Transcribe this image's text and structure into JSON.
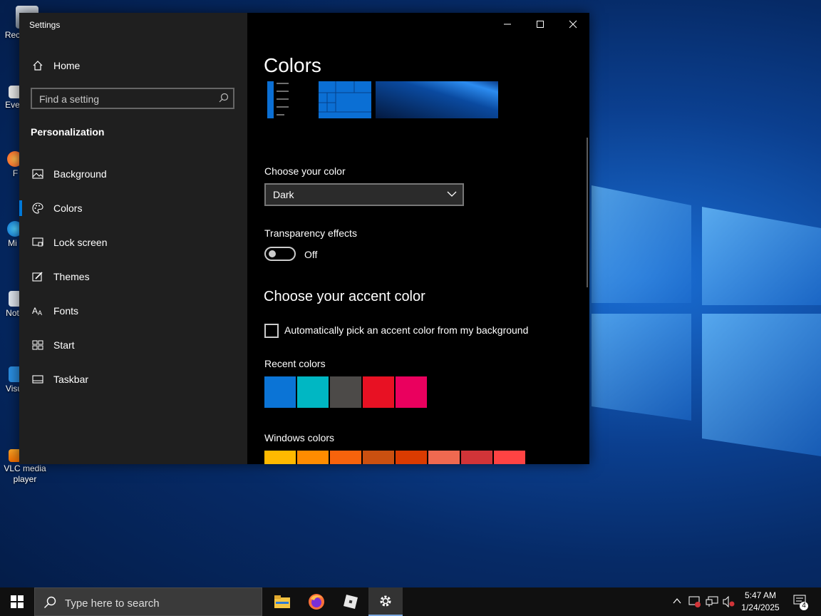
{
  "desktop": {
    "icons": [
      {
        "label": "Rec"
      },
      {
        "label": "Eve"
      },
      {
        "label": "F"
      },
      {
        "label": "Mi"
      },
      {
        "label": "Not"
      },
      {
        "label": "Visu"
      },
      {
        "label": "VLC media player"
      }
    ]
  },
  "window": {
    "title": "Settings",
    "sidebar": {
      "home_label": "Home",
      "search_placeholder": "Find a setting",
      "section_title": "Personalization",
      "items": [
        {
          "label": "Background",
          "icon": "picture-icon"
        },
        {
          "label": "Colors",
          "icon": "palette-icon",
          "selected": true
        },
        {
          "label": "Lock screen",
          "icon": "lock-screen-icon"
        },
        {
          "label": "Themes",
          "icon": "brush-icon"
        },
        {
          "label": "Fonts",
          "icon": "font-icon"
        },
        {
          "label": "Start",
          "icon": "start-grid-icon"
        },
        {
          "label": "Taskbar",
          "icon": "taskbar-icon"
        }
      ]
    },
    "content": {
      "page_title": "Colors",
      "choose_color_label": "Choose your color",
      "choose_color_value": "Dark",
      "transparency_label": "Transparency effects",
      "transparency_state": "Off",
      "accent_heading": "Choose your accent color",
      "auto_accent_label": "Automatically pick an accent color from my background",
      "auto_accent_checked": false,
      "recent_colors_label": "Recent colors",
      "recent_colors": [
        "#0b74d6",
        "#00b7c3",
        "#4c4a48",
        "#e81123",
        "#ea005e"
      ],
      "windows_colors_label": "Windows colors",
      "windows_colors": [
        "#ffb900",
        "#ff8c00",
        "#f7630c",
        "#ca5010",
        "#da3b01",
        "#ef6950",
        "#d13438",
        "#ff4343"
      ]
    }
  },
  "taskbar": {
    "search_placeholder": "Type here to search",
    "time": "5:47 AM",
    "date": "1/24/2025",
    "notification_count": "4"
  },
  "colors": {
    "accent": "#0078d7",
    "sidebar_bg": "#1f1f1f",
    "content_bg": "#000000"
  }
}
